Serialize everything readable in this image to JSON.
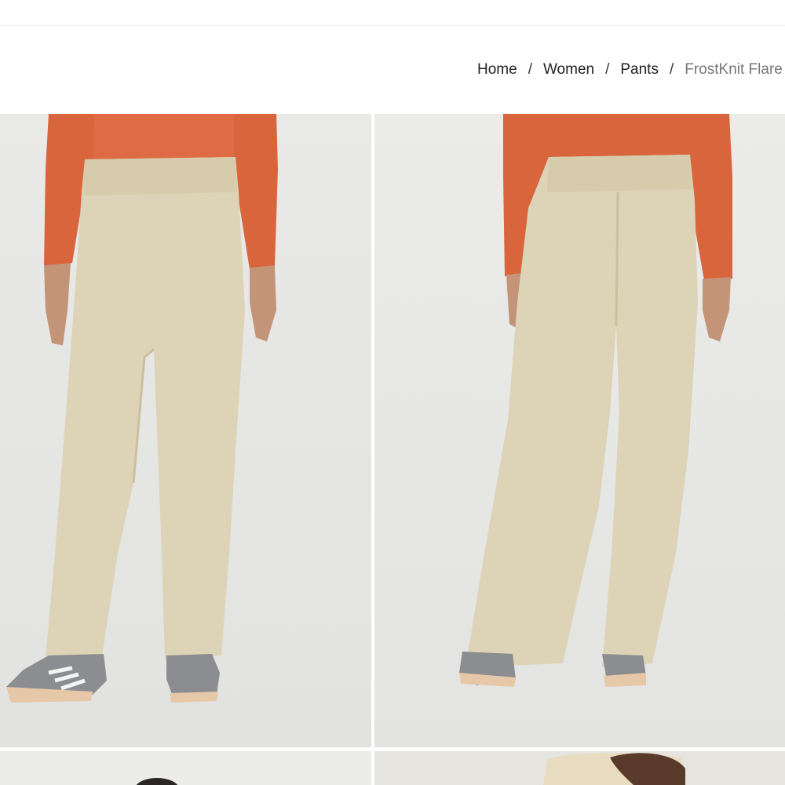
{
  "breadcrumb": {
    "items": [
      {
        "label": "Home"
      },
      {
        "label": "Women"
      },
      {
        "label": "Pants"
      }
    ],
    "separator": "/",
    "current": "FrostKnit Flare"
  },
  "gallery": {
    "images": [
      {
        "name": "product-photo-front",
        "view": "front"
      },
      {
        "name": "product-photo-back",
        "view": "back"
      },
      {
        "name": "product-photo-3",
        "view": "partial"
      },
      {
        "name": "product-photo-4",
        "view": "partial"
      }
    ]
  },
  "colors": {
    "text": "#222222",
    "muted": "#777777",
    "photo_background": "#e8e8e6",
    "pants": "#ddd3b6",
    "top": "#d9653d",
    "shoe": "#8b8d90"
  }
}
